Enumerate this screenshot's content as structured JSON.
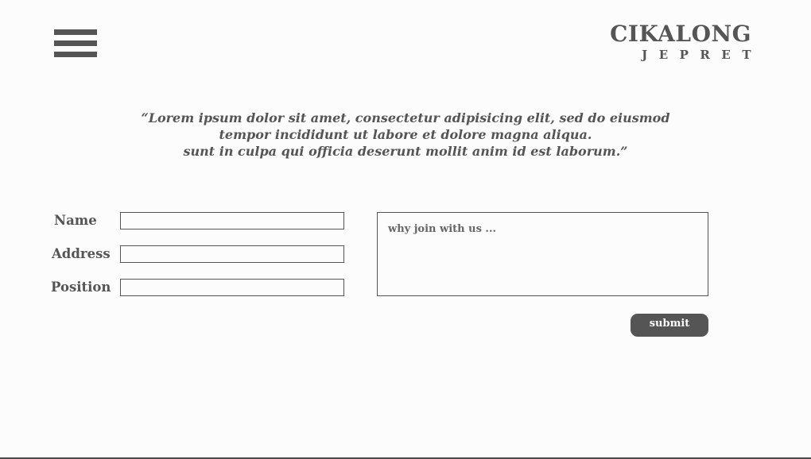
{
  "header": {
    "menu_icon": "hamburger-menu-icon",
    "logo_title": "CIKALONG",
    "logo_subtitle": "JEPRET"
  },
  "quote": {
    "line1": "“Lorem ipsum dolor sit amet, consectetur adipisicing elit, sed do eiusmod",
    "line2": "tempor incididunt ut labore et dolore magna aliqua.",
    "line3": "sunt in culpa qui officia deserunt mollit anim id est laborum.”"
  },
  "form": {
    "name_label": "Name",
    "name_value": "",
    "address_label": "Address",
    "address_value": "",
    "position_label": "Position",
    "position_value": "",
    "message_placeholder": "why join with us ...",
    "submit_label": "submit"
  },
  "colors": {
    "text": "#555555",
    "background": "#fcfcfc",
    "button_bg": "#555555",
    "button_text": "#ffffff"
  }
}
